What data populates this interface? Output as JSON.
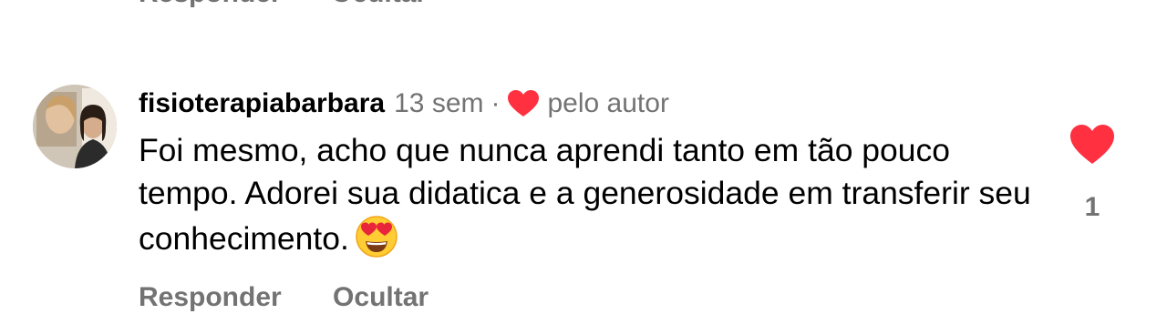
{
  "previous_comment": {
    "reply_label": "Responder",
    "hide_label": "Ocultar"
  },
  "comment": {
    "username": "fisioterapiabarbara",
    "time": "13 sem",
    "separator": "·",
    "author_like_label": "pelo autor",
    "text": "Foi mesmo, acho que nunca aprendi tanto em tão pouco tempo. Adorei sua didatica e a generosidade em transferir seu conhecimento.",
    "emoji": "heart-eyes-emoji",
    "like_icon": "heart-filled-icon",
    "like_count": "1",
    "reply_label": "Responder",
    "hide_label": "Ocultar"
  },
  "colors": {
    "heart": "#ff3040",
    "secondary_text": "#737373",
    "primary_text": "#000000"
  }
}
